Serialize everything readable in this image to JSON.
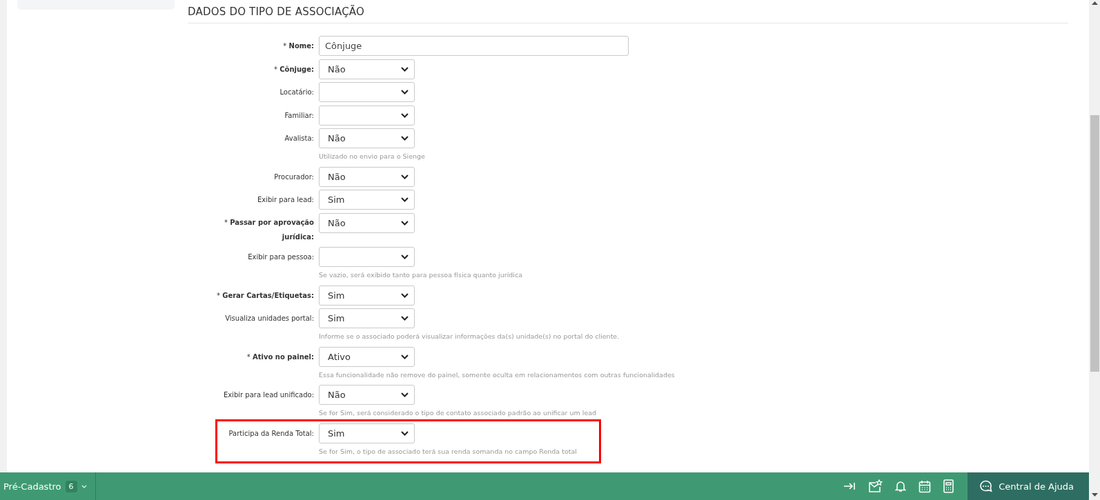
{
  "section_title": "DADOS DO TIPO DE ASSOCIAÇÃO",
  "fields": [
    {
      "kind": "input",
      "label": "* **Nome:**",
      "value": "Cônjuge",
      "highlighted": false
    },
    {
      "kind": "select",
      "label": "* **Cônjuge:**",
      "value": "Não",
      "highlighted": false
    },
    {
      "kind": "select",
      "label": "Locatário:",
      "highlighted": false
    },
    {
      "kind": "select",
      "label": "Familiar:",
      "highlighted": false
    },
    {
      "kind": "select",
      "label": "Avalista:",
      "value": "Não",
      "hint": "Utilizado no envio para o Sienge",
      "highlighted": false
    },
    {
      "kind": "select",
      "label": "Procurador:",
      "value": "Não",
      "highlighted": false
    },
    {
      "kind": "select",
      "label": "Exibir para lead:",
      "value": "Sim",
      "highlighted": false
    },
    {
      "kind": "select",
      "label": "* **Passar por aprovação jurídica:**",
      "value": "Não",
      "highlighted": false
    },
    {
      "kind": "select",
      "label": "Exibir para pessoa:",
      "hint": "Se vazio, será exibido tanto para pessoa física quanto jurídica",
      "highlighted": false
    },
    {
      "kind": "select",
      "label": "* **Gerar Cartas/Etiquetas:**",
      "value": "Sim",
      "highlighted": false
    },
    {
      "kind": "select",
      "label": "Visualiza unidades portal:",
      "value": "Sim",
      "hint": "Informe se o associado poderá visualizar informações da(s) unidade(s) no portal do cliente.",
      "highlighted": false
    },
    {
      "kind": "select",
      "label": "* **Ativo no painel:**",
      "value": "Ativo",
      "hint": "Essa funcionalidade não remove do painel, somente oculta em relacionamentos com outras funcionalidades",
      "highlighted": false
    },
    {
      "kind": "select",
      "label": "Exibir para lead unificado:",
      "value": "Não",
      "hint": "Se for Sim, será considerado o tipo de contato associado padrão ao unificar um lead",
      "highlighted": false
    },
    {
      "kind": "select",
      "label": "Participa da Renda Total:",
      "value": "Sim",
      "hint": "Se for Sim, o tipo de associado terá sua renda somanda no campo Renda total",
      "highlighted": true
    }
  ],
  "bottom_bar": {
    "module": "Pré-Cadastro",
    "count": "6",
    "help": "Central de Ajuda"
  }
}
